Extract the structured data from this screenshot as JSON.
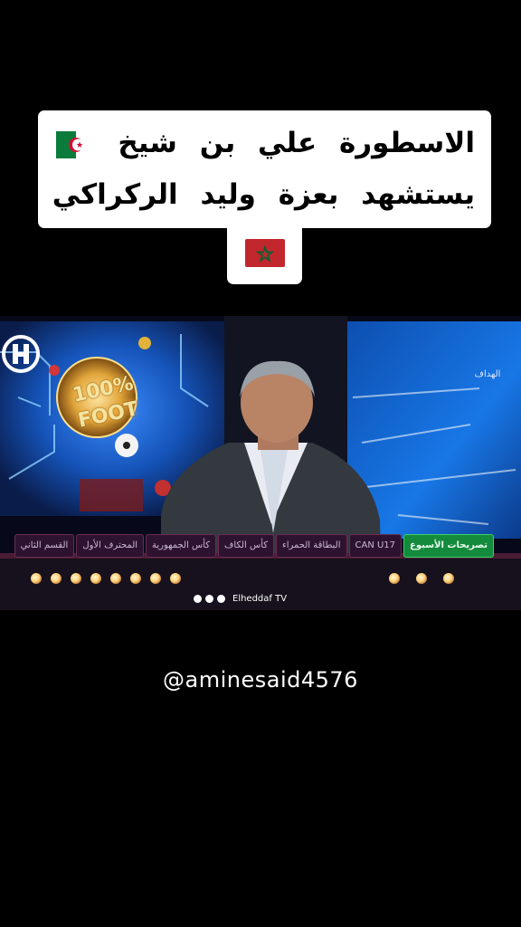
{
  "caption": {
    "line1": "الاسطورة علي بن شيخ",
    "line2": "يستشهد بعزة وليد الركراكي",
    "flags": [
      "algeria-flag",
      "morocco-flag"
    ]
  },
  "video": {
    "backdrop_text": {
      "line1": "100%",
      "line2": "FOOT"
    },
    "channel": {
      "logo": "elheddaf-logo",
      "name": "الهداف"
    },
    "ticker": [
      {
        "label": "تصريحات الأسبوع",
        "active": true
      },
      {
        "label": "CAN U17",
        "active": false,
        "latin": true
      },
      {
        "label": "البطاقة الحمراء",
        "active": false
      },
      {
        "label": "كأس الكاف",
        "active": false
      },
      {
        "label": "كأس الجمهورية",
        "active": false
      },
      {
        "label": "المحترف الأول",
        "active": false
      },
      {
        "label": "القسم الثاني",
        "active": false
      }
    ],
    "social_handle": "Elheddaf TV"
  },
  "watermark": "@aminesaid4576",
  "colors": {
    "background": "#000000",
    "caption_bg": "#ffffff",
    "ticker_active": "#148a3c",
    "screen_blue": "#1b6fd8"
  }
}
